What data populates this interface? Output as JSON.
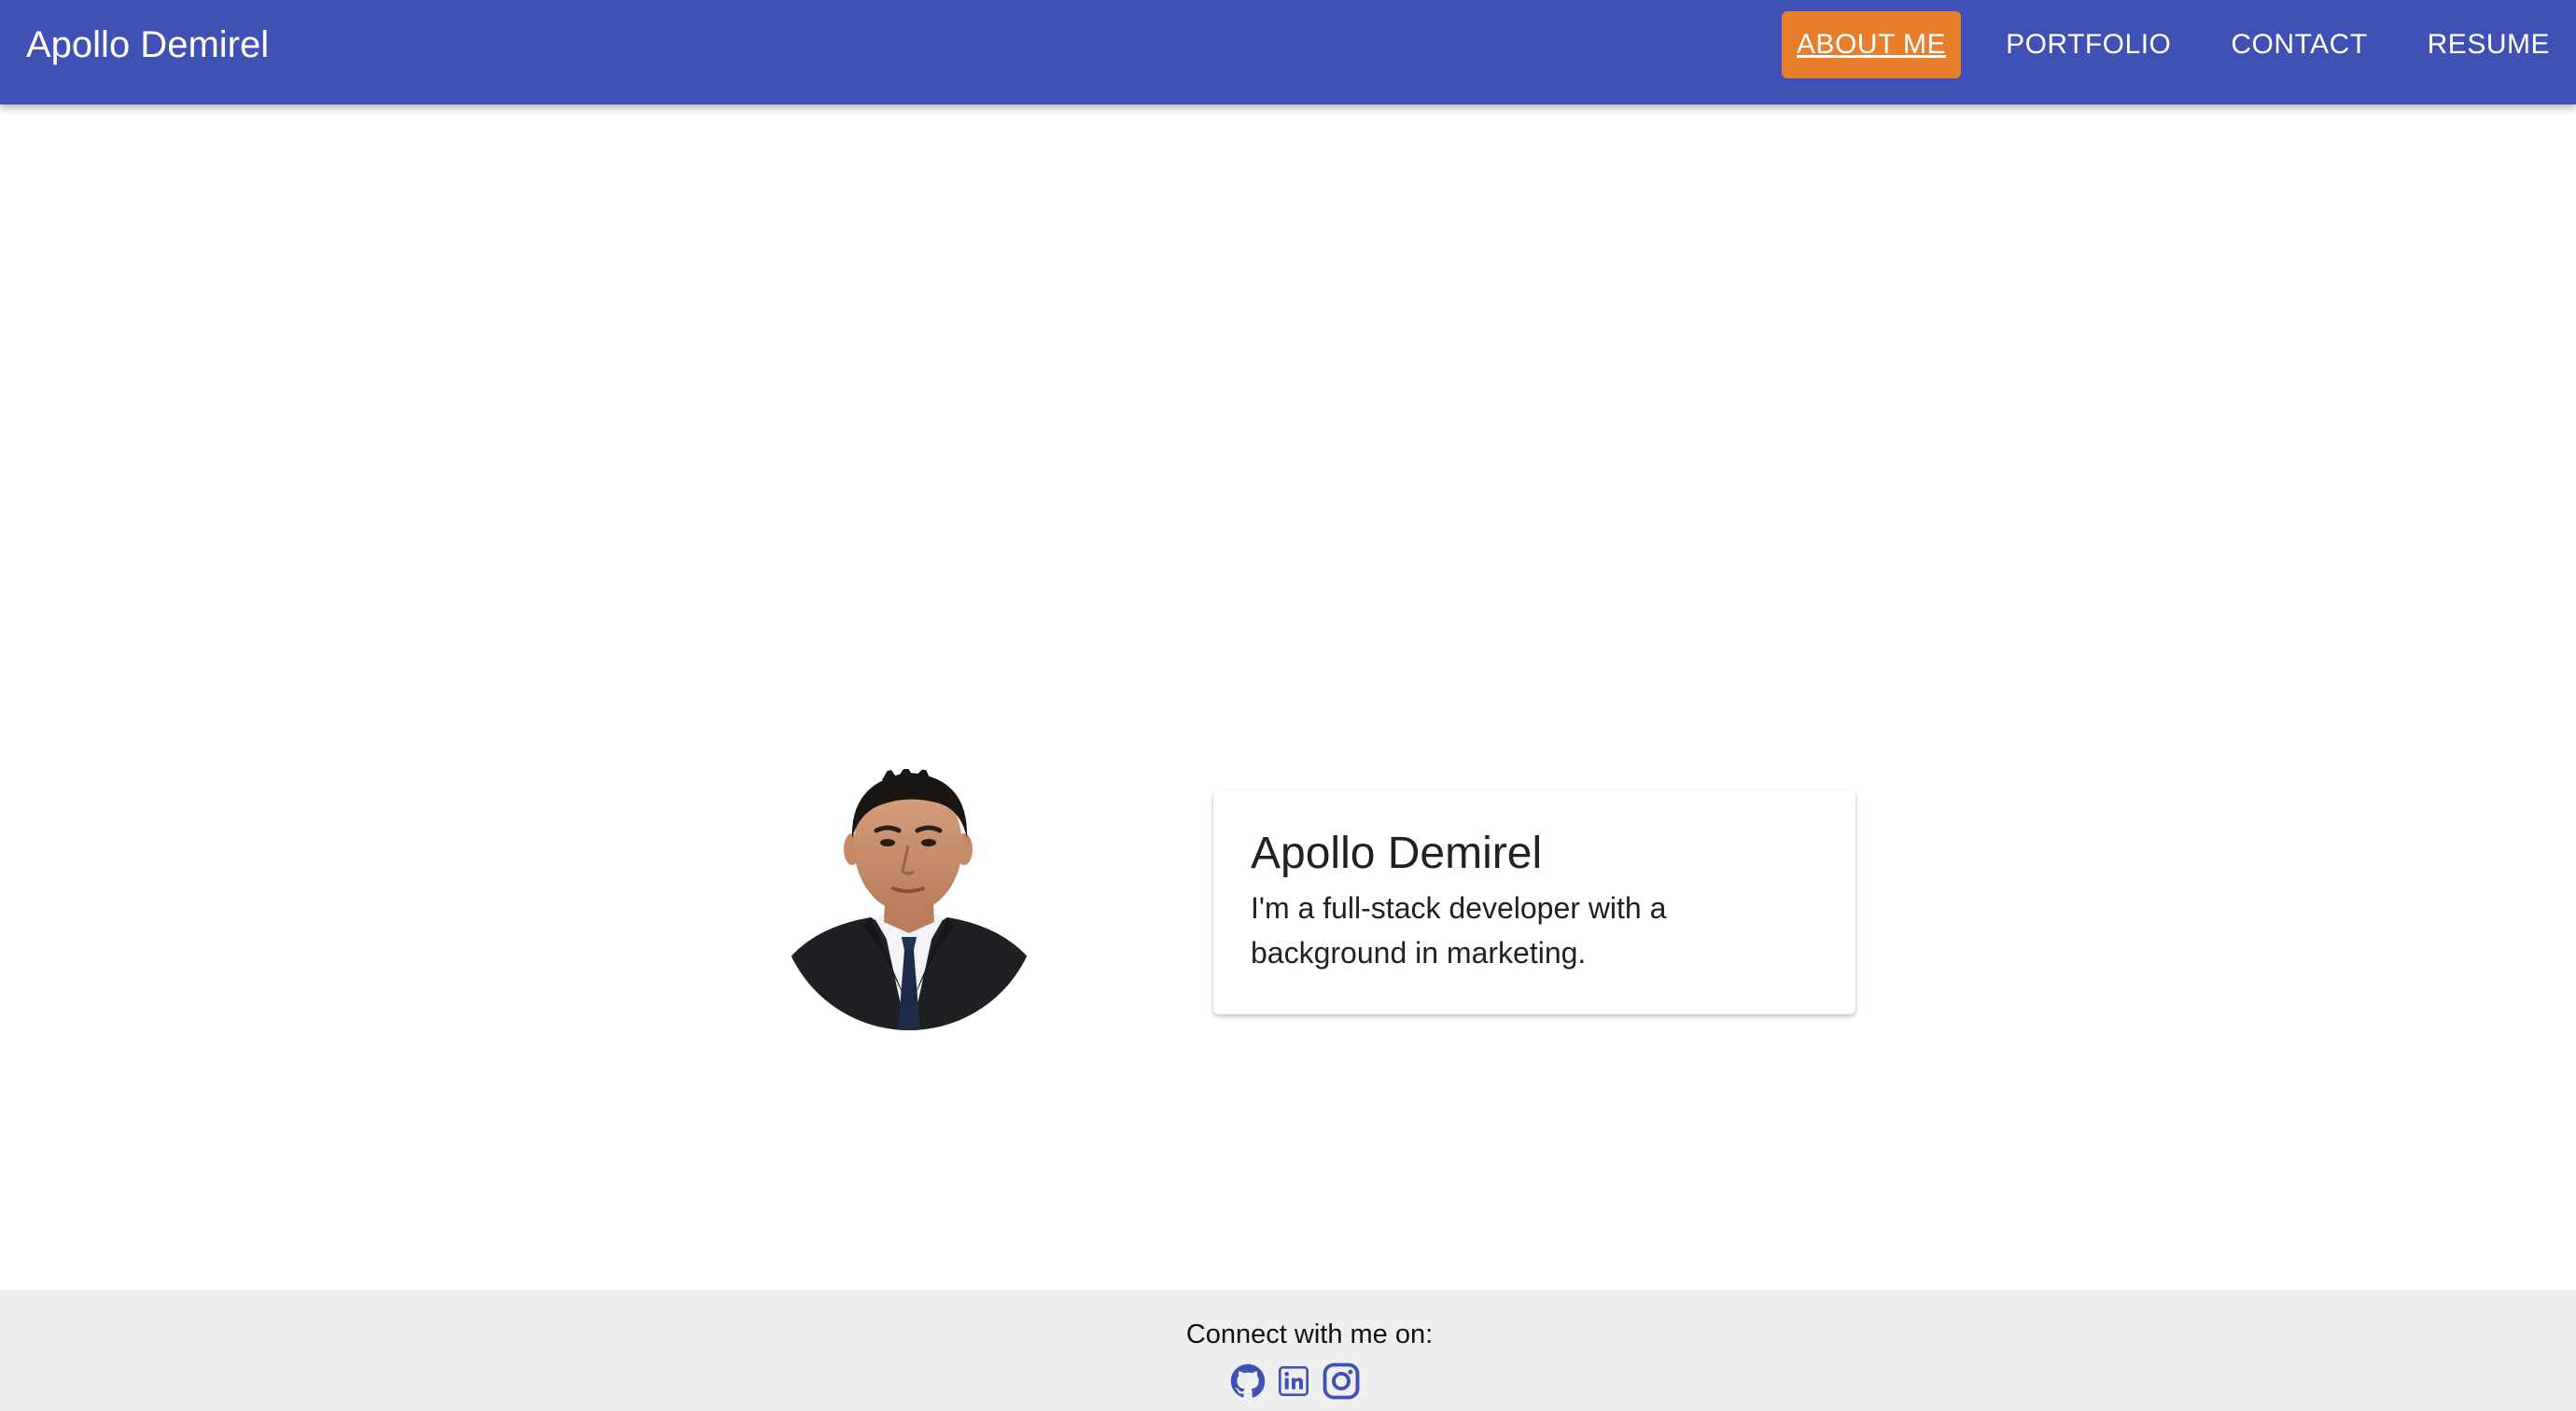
{
  "header": {
    "brand": "Apollo Demirel",
    "nav": [
      {
        "label": "ABOUT ME",
        "active": true
      },
      {
        "label": "PORTFOLIO",
        "active": false
      },
      {
        "label": "CONTACT",
        "active": false
      },
      {
        "label": "RESUME",
        "active": false
      }
    ]
  },
  "about": {
    "name": "Apollo Demirel",
    "bio": "I'm a full-stack developer with a background in marketing.",
    "avatar_icon": "profile-photo"
  },
  "footer": {
    "connect_label": "Connect with me on:",
    "socials": [
      {
        "icon": "github-icon"
      },
      {
        "icon": "linkedin-icon"
      },
      {
        "icon": "instagram-icon"
      }
    ]
  },
  "colors": {
    "header_bg": "#3f51b5",
    "active_nav_bg": "#e67e2c",
    "footer_bg": "#efefef",
    "social_icon": "#3f51b5"
  }
}
